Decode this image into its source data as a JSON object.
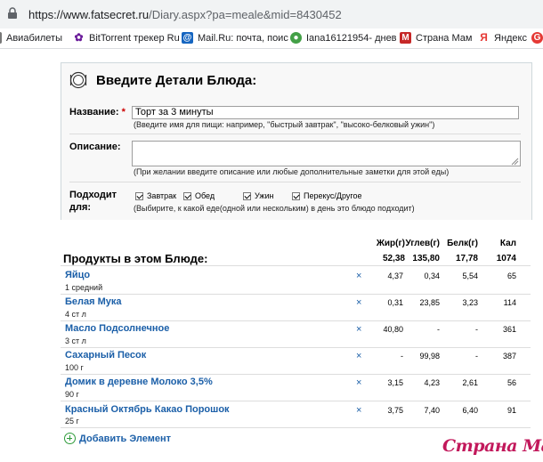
{
  "browser": {
    "url_host": "https://www.fatsecret.ru",
    "url_path": "/Diary.aspx?pa=meale&mid=8430452",
    "bookmarks": [
      {
        "label": "Авиабилеты",
        "icon": "bookmark-icon",
        "color": "#555555"
      },
      {
        "label": "BitTorrent трекер Ru",
        "icon": "torrent-icon",
        "color": "#6a1b9a"
      },
      {
        "label": "Mail.Ru: почта, поис",
        "icon": "mailru-icon",
        "color": "#1565c0"
      },
      {
        "label": "Iana16121954- днев",
        "icon": "diary-icon",
        "color": "#43a047"
      },
      {
        "label": "Страна Мам",
        "icon": "stranamam-icon",
        "color": "#c62828"
      },
      {
        "label": "Яндекс",
        "icon": "yandex-icon",
        "color": "#e53935"
      }
    ]
  },
  "form": {
    "title": "Введите Детали Блюда:",
    "name_label": "Название:",
    "required_mark": "*",
    "name_value": "Торт за 3 минуты",
    "name_hint": "(Введите имя для пищи: например, \"быстрый завтрак\", \"высоко-белковый ужин\")",
    "desc_label": "Описание:",
    "desc_value": "",
    "desc_hint": "(При желании введите описание или любые дополнительные заметки для этой еды)",
    "fits_label_1": "Подходит",
    "fits_label_2": "для:",
    "meals": [
      {
        "label": "Завтрак",
        "checked": true
      },
      {
        "label": "Обед",
        "checked": true
      },
      {
        "label": "Ужин",
        "checked": true
      },
      {
        "label": "Перекус/Другое",
        "checked": true
      }
    ],
    "fits_hint": "(Выбирите, к какой еде(одной или нескольким) в день это блюдо подходит)"
  },
  "products": {
    "heading": "Продукты в этом Блюде:",
    "columns": [
      "Жир(г)",
      "Углев(г)",
      "Белк(г)",
      "Кал"
    ],
    "totals": [
      "52,38",
      "135,80",
      "17,78",
      "1074"
    ],
    "remove_label": "×",
    "items": [
      {
        "name": "Яйцо",
        "qty": "1 средний",
        "fat": "4,37",
        "carb": "0,34",
        "prot": "5,54",
        "cal": "65"
      },
      {
        "name": "Белая Мука",
        "qty": "4 ст л",
        "fat": "0,31",
        "carb": "23,85",
        "prot": "3,23",
        "cal": "114"
      },
      {
        "name": "Масло Подсолнечное",
        "qty": "3 ст л",
        "fat": "40,80",
        "carb": "-",
        "prot": "-",
        "cal": "361"
      },
      {
        "name": "Сахарный Песок",
        "qty": "100 г",
        "fat": "-",
        "carb": "99,98",
        "prot": "-",
        "cal": "387"
      },
      {
        "name": "Домик в деревне Молоко 3,5%",
        "qty": "90 г",
        "fat": "3,15",
        "carb": "4,23",
        "prot": "2,61",
        "cal": "56"
      },
      {
        "name": "Красный Октябрь Какао Порошок",
        "qty": "25 г",
        "fat": "3,75",
        "carb": "7,40",
        "prot": "6,40",
        "cal": "91"
      }
    ],
    "add_label": "Добавить Элемент"
  },
  "watermark": "Страна Мам"
}
